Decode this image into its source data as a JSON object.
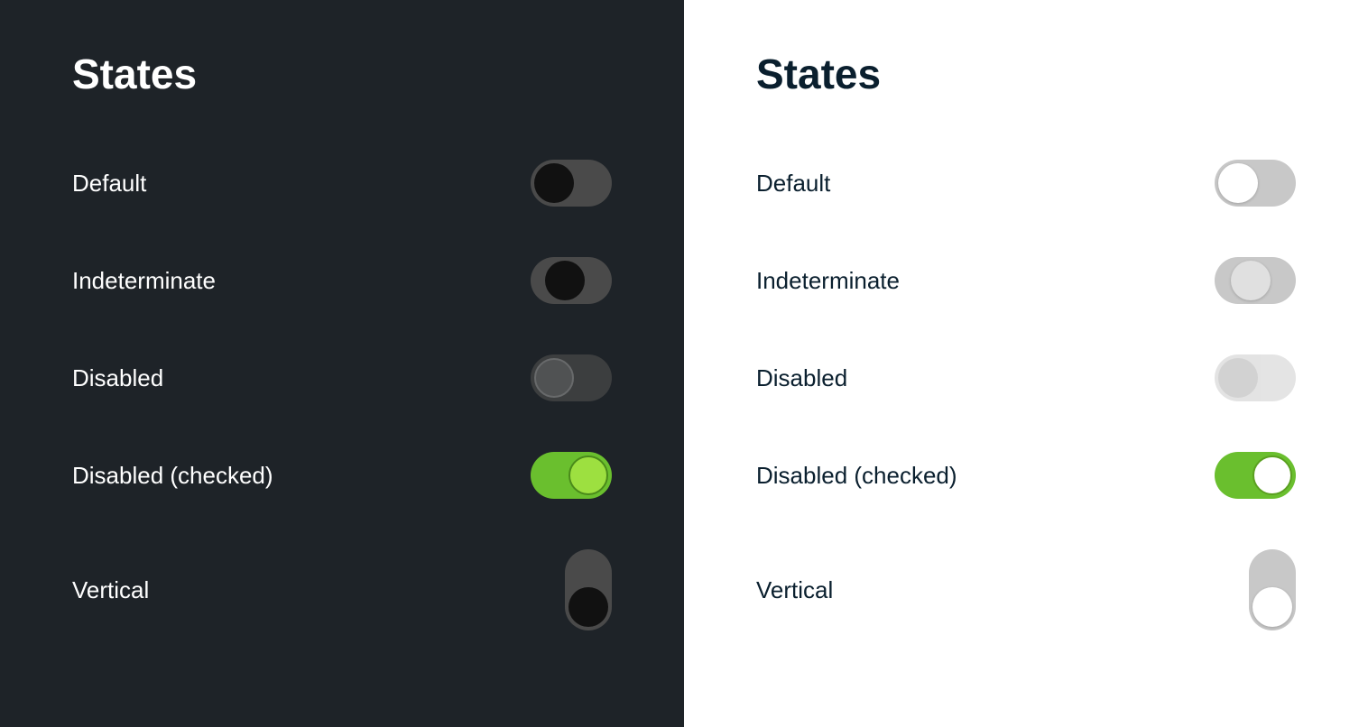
{
  "dark_panel": {
    "title": "States",
    "rows": [
      {
        "id": "default",
        "label": "Default"
      },
      {
        "id": "indeterminate",
        "label": "Indeterminate"
      },
      {
        "id": "disabled",
        "label": "Disabled"
      },
      {
        "id": "disabled-checked",
        "label": "Disabled (checked)"
      },
      {
        "id": "vertical",
        "label": "Vertical"
      }
    ]
  },
  "light_panel": {
    "title": "States",
    "rows": [
      {
        "id": "default",
        "label": "Default"
      },
      {
        "id": "indeterminate",
        "label": "Indeterminate"
      },
      {
        "id": "disabled",
        "label": "Disabled"
      },
      {
        "id": "disabled-checked",
        "label": "Disabled (checked)"
      },
      {
        "id": "vertical",
        "label": "Vertical"
      }
    ]
  }
}
